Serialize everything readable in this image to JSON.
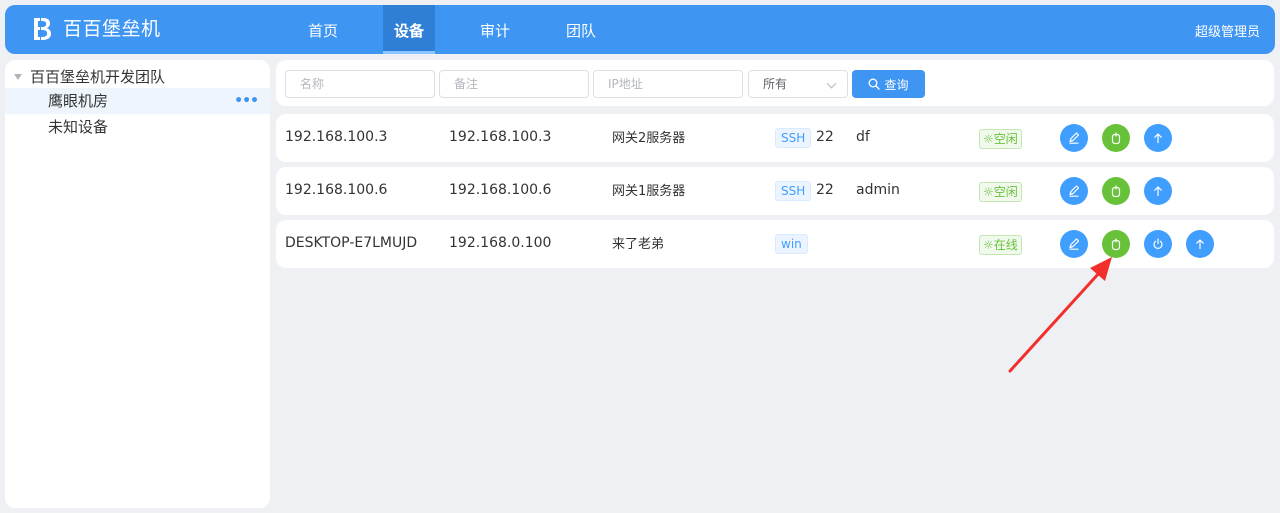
{
  "app": {
    "title": "百百堡垒机",
    "user_label": "超级管理员"
  },
  "nav": {
    "items": [
      {
        "label": "首页",
        "active": false
      },
      {
        "label": "设备",
        "active": true
      },
      {
        "label": "审计",
        "active": false
      },
      {
        "label": "团队",
        "active": false
      }
    ]
  },
  "sidebar": {
    "root": "百百堡垒机开发团队",
    "children": [
      {
        "label": "鹰眼机房",
        "selected": true,
        "more": "•••"
      },
      {
        "label": "未知设备",
        "selected": false
      }
    ]
  },
  "search": {
    "name_placeholder": "名称",
    "note_placeholder": "备注",
    "ip_placeholder": "IP地址",
    "select_value": "所有",
    "query_label": "查询"
  },
  "devices": [
    {
      "name": "192.168.100.3",
      "ip": "192.168.100.3",
      "desc": "网关2服务器",
      "protocol": "SSH",
      "port": "22",
      "user": "df",
      "status": "☼空闲",
      "actions": [
        "edit-icon",
        "mouse-icon",
        "upload-icon"
      ]
    },
    {
      "name": "192.168.100.6",
      "ip": "192.168.100.6",
      "desc": "网关1服务器",
      "protocol": "SSH",
      "port": "22",
      "user": "admin",
      "status": "☼空闲",
      "actions": [
        "edit-icon",
        "mouse-icon",
        "upload-icon"
      ]
    },
    {
      "name": "DESKTOP-E7LMUJD",
      "ip": "192.168.0.100",
      "desc": "来了老弟",
      "protocol": "win",
      "port": "",
      "user": "",
      "status": "☼在线",
      "actions": [
        "edit-icon",
        "mouse-icon",
        "power-icon",
        "upload-icon"
      ]
    }
  ],
  "colors": {
    "brand": "#3f95f2",
    "background": "#eff0f4",
    "action_blue": "#409eff",
    "action_green": "#67c23a",
    "annotation_red": "#f2302b"
  }
}
